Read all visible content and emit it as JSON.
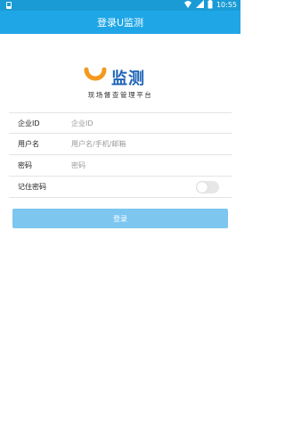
{
  "status_bar": {
    "time": "10:55",
    "icons": [
      "wifi-icon",
      "signal-icon",
      "battery-icon",
      "notification-icon"
    ]
  },
  "app_bar": {
    "title": "登录U监测"
  },
  "logo": {
    "title": "监测",
    "subtitle": "现场督查管理平台"
  },
  "form": {
    "company_id": {
      "label": "企业ID",
      "placeholder": "企业ID",
      "value": ""
    },
    "username": {
      "label": "用户名",
      "placeholder": "用户名/手机/邮箱",
      "value": ""
    },
    "password": {
      "label": "密码",
      "placeholder": "密码",
      "value": ""
    },
    "remember": {
      "label": "记住密码",
      "checked": false
    }
  },
  "login_button": {
    "label": "登录"
  },
  "colors": {
    "status_bar": "#1a9bd6",
    "app_bar": "#1fa6e6",
    "logo_orange": "#f39a1e",
    "logo_blue": "#1c63b7",
    "button": "#7cc6f0"
  }
}
